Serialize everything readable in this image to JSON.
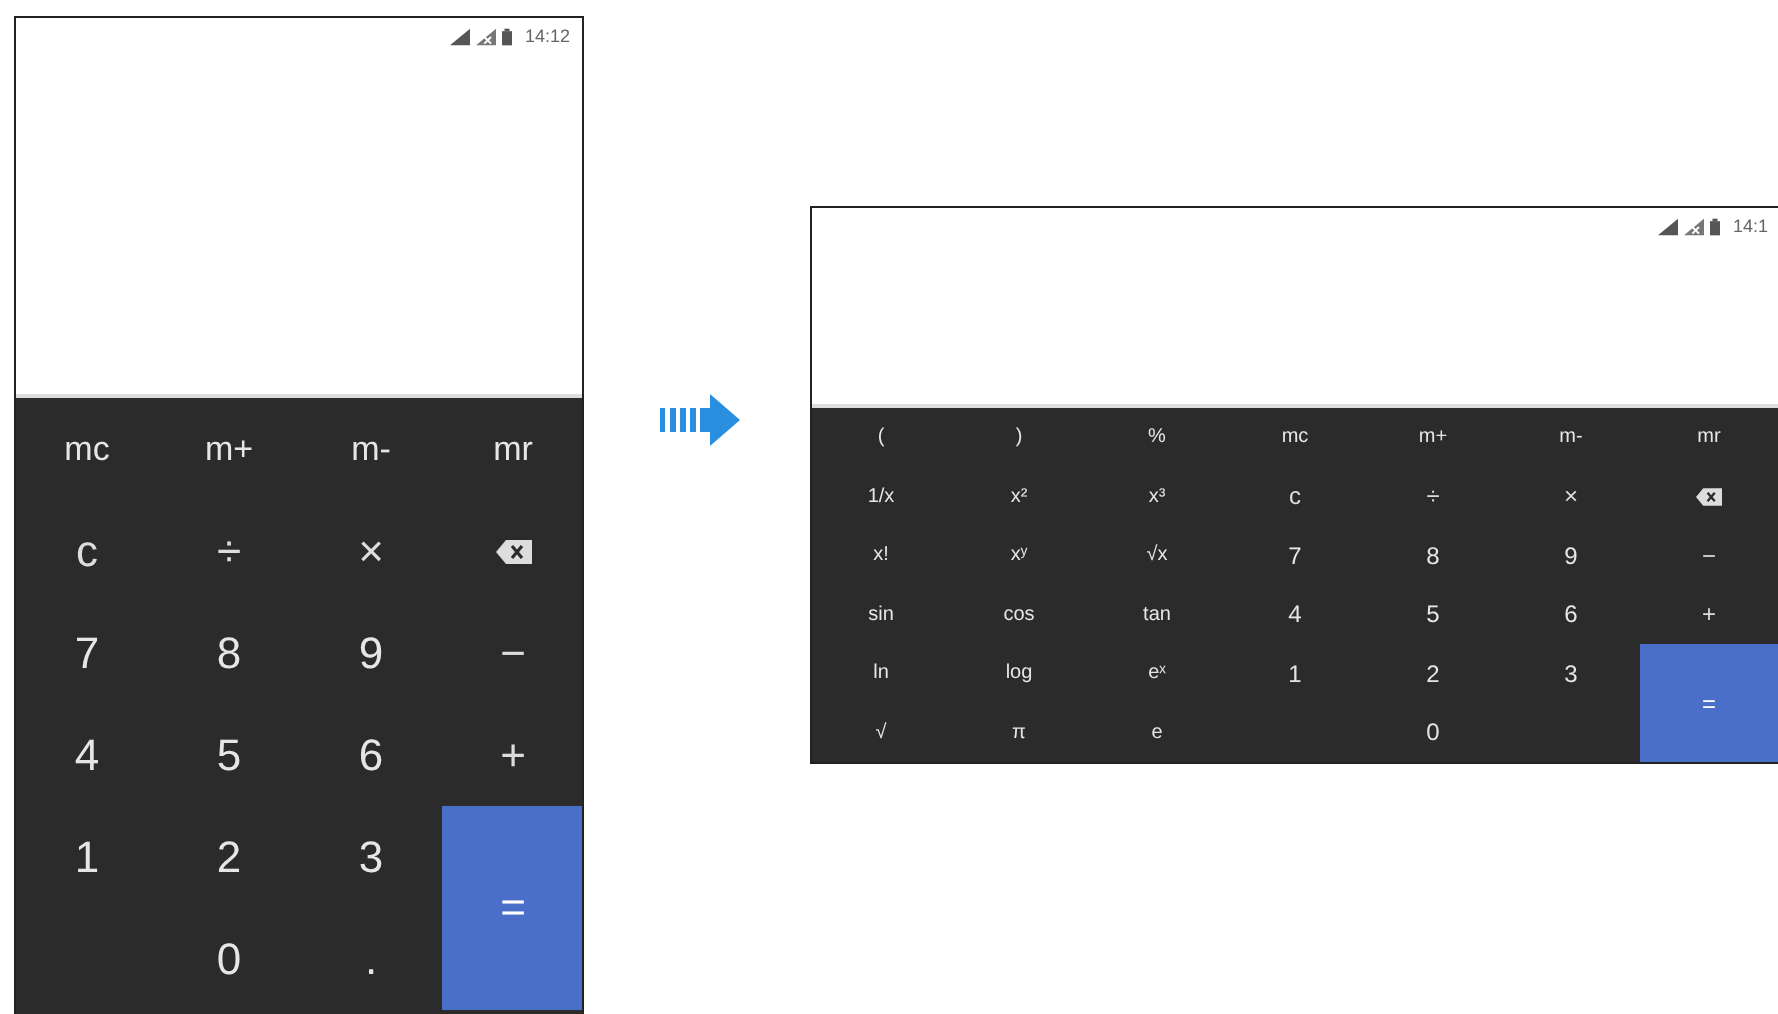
{
  "portrait": {
    "status_time": "14:12",
    "keys": [
      {
        "kind": "memory",
        "label": "mc"
      },
      {
        "kind": "memory",
        "label": "m+"
      },
      {
        "kind": "memory",
        "label": "m-"
      },
      {
        "kind": "memory",
        "label": "mr"
      },
      {
        "kind": "op",
        "label": "c"
      },
      {
        "kind": "op",
        "label": "÷"
      },
      {
        "kind": "op",
        "label": "×"
      },
      {
        "kind": "backspace"
      },
      {
        "kind": "digit",
        "label": "7"
      },
      {
        "kind": "digit",
        "label": "8"
      },
      {
        "kind": "digit",
        "label": "9"
      },
      {
        "kind": "op",
        "label": "−"
      },
      {
        "kind": "digit",
        "label": "4"
      },
      {
        "kind": "digit",
        "label": "5"
      },
      {
        "kind": "digit",
        "label": "6"
      },
      {
        "kind": "op",
        "label": "+"
      },
      {
        "kind": "digit",
        "label": "1"
      },
      {
        "kind": "digit",
        "label": "2"
      },
      {
        "kind": "digit",
        "label": "3"
      },
      {
        "kind": "equals",
        "label": "="
      },
      {
        "kind": "blank"
      },
      {
        "kind": "digit",
        "label": "0"
      },
      {
        "kind": "digit",
        "label": "."
      }
    ]
  },
  "landscape": {
    "status_time": "14:1",
    "keys": [
      {
        "kind": "sci",
        "label": "("
      },
      {
        "kind": "sci",
        "label": ")"
      },
      {
        "kind": "sci",
        "label": "%"
      },
      {
        "kind": "memory",
        "label": "mc"
      },
      {
        "kind": "memory",
        "label": "m+"
      },
      {
        "kind": "memory",
        "label": "m-"
      },
      {
        "kind": "memory",
        "label": "mr"
      },
      {
        "kind": "sci",
        "label": "1/x"
      },
      {
        "kind": "sci",
        "label": "x²"
      },
      {
        "kind": "sci",
        "label": "x³"
      },
      {
        "kind": "op",
        "label": "c"
      },
      {
        "kind": "op",
        "label": "÷"
      },
      {
        "kind": "op",
        "label": "×"
      },
      {
        "kind": "backspace"
      },
      {
        "kind": "sci",
        "label": "x!"
      },
      {
        "kind": "sci",
        "label": "xʸ"
      },
      {
        "kind": "sci",
        "label": "√x"
      },
      {
        "kind": "digit",
        "label": "7"
      },
      {
        "kind": "digit",
        "label": "8"
      },
      {
        "kind": "digit",
        "label": "9"
      },
      {
        "kind": "op",
        "label": "−"
      },
      {
        "kind": "sci",
        "label": "sin"
      },
      {
        "kind": "sci",
        "label": "cos"
      },
      {
        "kind": "sci",
        "label": "tan"
      },
      {
        "kind": "digit",
        "label": "4"
      },
      {
        "kind": "digit",
        "label": "5"
      },
      {
        "kind": "digit",
        "label": "6"
      },
      {
        "kind": "op",
        "label": "+"
      },
      {
        "kind": "sci",
        "label": "ln"
      },
      {
        "kind": "sci",
        "label": "log"
      },
      {
        "kind": "sci",
        "label": "eˣ"
      },
      {
        "kind": "digit",
        "label": "1"
      },
      {
        "kind": "digit",
        "label": "2"
      },
      {
        "kind": "digit",
        "label": "3"
      },
      {
        "kind": "equals",
        "label": "="
      },
      {
        "kind": "sci",
        "label": "√"
      },
      {
        "kind": "sci",
        "label": "π"
      },
      {
        "kind": "sci",
        "label": "e"
      },
      {
        "kind": "blank"
      },
      {
        "kind": "digit",
        "label": "0"
      },
      {
        "kind": "blank"
      }
    ]
  }
}
